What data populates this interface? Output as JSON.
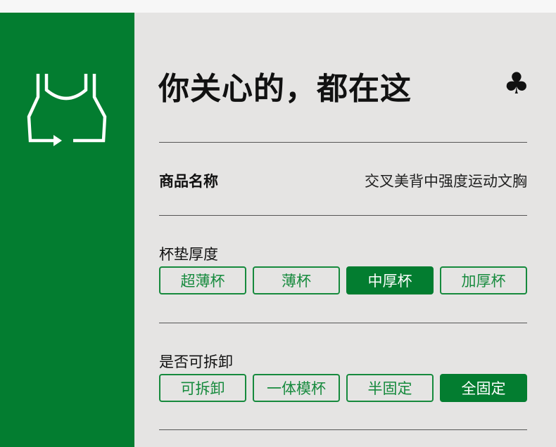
{
  "title": "你关心的，都在这",
  "title_icon": "club-icon",
  "product_name": {
    "label": "商品名称",
    "value": "交叉美背中强度运动文胸"
  },
  "cup_thickness": {
    "label": "杯垫厚度",
    "options": [
      "超薄杯",
      "薄杯",
      "中厚杯",
      "加厚杯"
    ],
    "selected": "中厚杯"
  },
  "removable": {
    "label": "是否可拆卸",
    "options": [
      "可拆卸",
      "一体模杯",
      "半固定",
      "全固定"
    ],
    "selected": "全固定"
  },
  "colors": {
    "brand_green": "#037d30",
    "panel_bg": "#e5e4e3"
  }
}
